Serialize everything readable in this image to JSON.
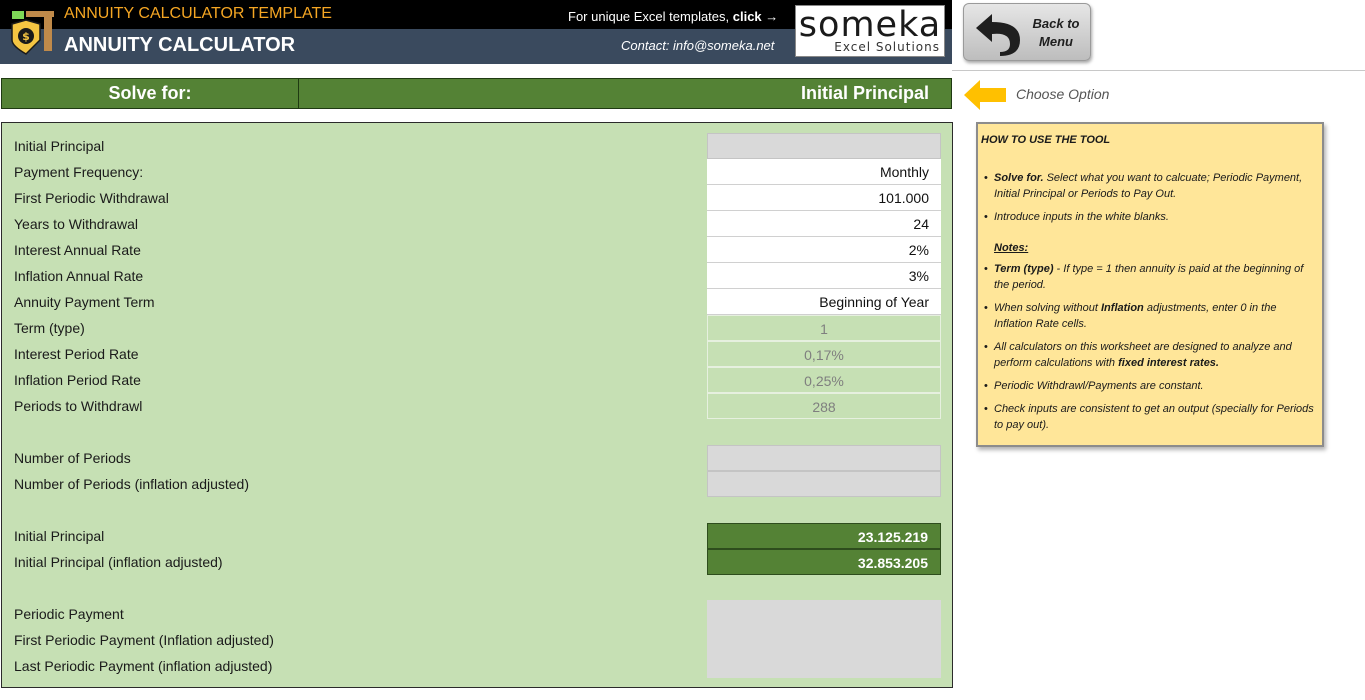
{
  "header": {
    "subtitle": "ANNUITY CALCULATOR TEMPLATE",
    "title": "ANNUITY CALCULATOR",
    "promo_text": "For unique Excel templates, ",
    "promo_link": "click →",
    "contact": "Contact: info@someka.net",
    "brand_name": "someka",
    "brand_sub": "Excel Solutions",
    "back_label": "Back to Menu"
  },
  "solve": {
    "label": "Solve for:",
    "value": "Initial Principal",
    "hint": "Choose Option"
  },
  "inputs": [
    {
      "label": "Initial Principal",
      "value": ""
    },
    {
      "label": "Payment Frequency:",
      "value": "Monthly"
    },
    {
      "label": "First Periodic Withdrawal",
      "value": "101.000"
    },
    {
      "label": "Years to Withdrawal",
      "value": "24"
    },
    {
      "label": "Interest Annual Rate",
      "value": "2%"
    },
    {
      "label": "Inflation Annual Rate",
      "value": "3%"
    },
    {
      "label": "Annuity Payment Term",
      "value": "Beginning of Year"
    },
    {
      "label": "Term (type)",
      "value": "1"
    },
    {
      "label": "Interest Period Rate",
      "value": "0,17%"
    },
    {
      "label": "Inflation Period Rate",
      "value": "0,25%"
    },
    {
      "label": "Periods to Withdrawl",
      "value": "288"
    }
  ],
  "periods": [
    {
      "label": "Number of Periods",
      "value": ""
    },
    {
      "label": "Number of Periods (inflation adjusted)",
      "value": ""
    }
  ],
  "principal": [
    {
      "label": "Initial Principal",
      "value": "23.125.219"
    },
    {
      "label": "Initial Principal (inflation adjusted)",
      "value": "32.853.205"
    }
  ],
  "payments": [
    {
      "label": "Periodic Payment"
    },
    {
      "label": "First Periodic Payment (Inflation adjusted)"
    },
    {
      "label": "Last Periodic Payment (inflation adjusted)"
    }
  ],
  "howto": {
    "title": "HOW TO USE THE TOOL",
    "b1_bold": "Solve for.",
    "b1_text": " Select what you want to calcuate; Periodic Payment, Initial Principal or Periods to Pay Out.",
    "b2_text": "Introduce inputs in the white blanks.",
    "notes": "Notes:",
    "n1_bold": "Term (type)",
    "n1_text": " - If type = 1  then annuity is paid at the beginning of the period.",
    "n2_pre": "When solving without ",
    "n2_bold": "Inflation",
    "n2_post": " adjustments, enter 0 in the Inflation Rate cells.",
    "n3_pre": "All calculators on this worksheet are designed to analyze and perform calculations with ",
    "n3_bold": "fixed interest rates.",
    "n4_text": "Periodic Withdrawl/Payments are constant.",
    "n5_text": "Check inputs are consistent to get an output (specially for Periods to pay out)."
  },
  "colors": {
    "panel": "#c6e0b4",
    "accent_green": "#548235",
    "header_band": "#3a4a5e",
    "subtitle": "#f5a623",
    "note_bg": "#ffe699"
  }
}
